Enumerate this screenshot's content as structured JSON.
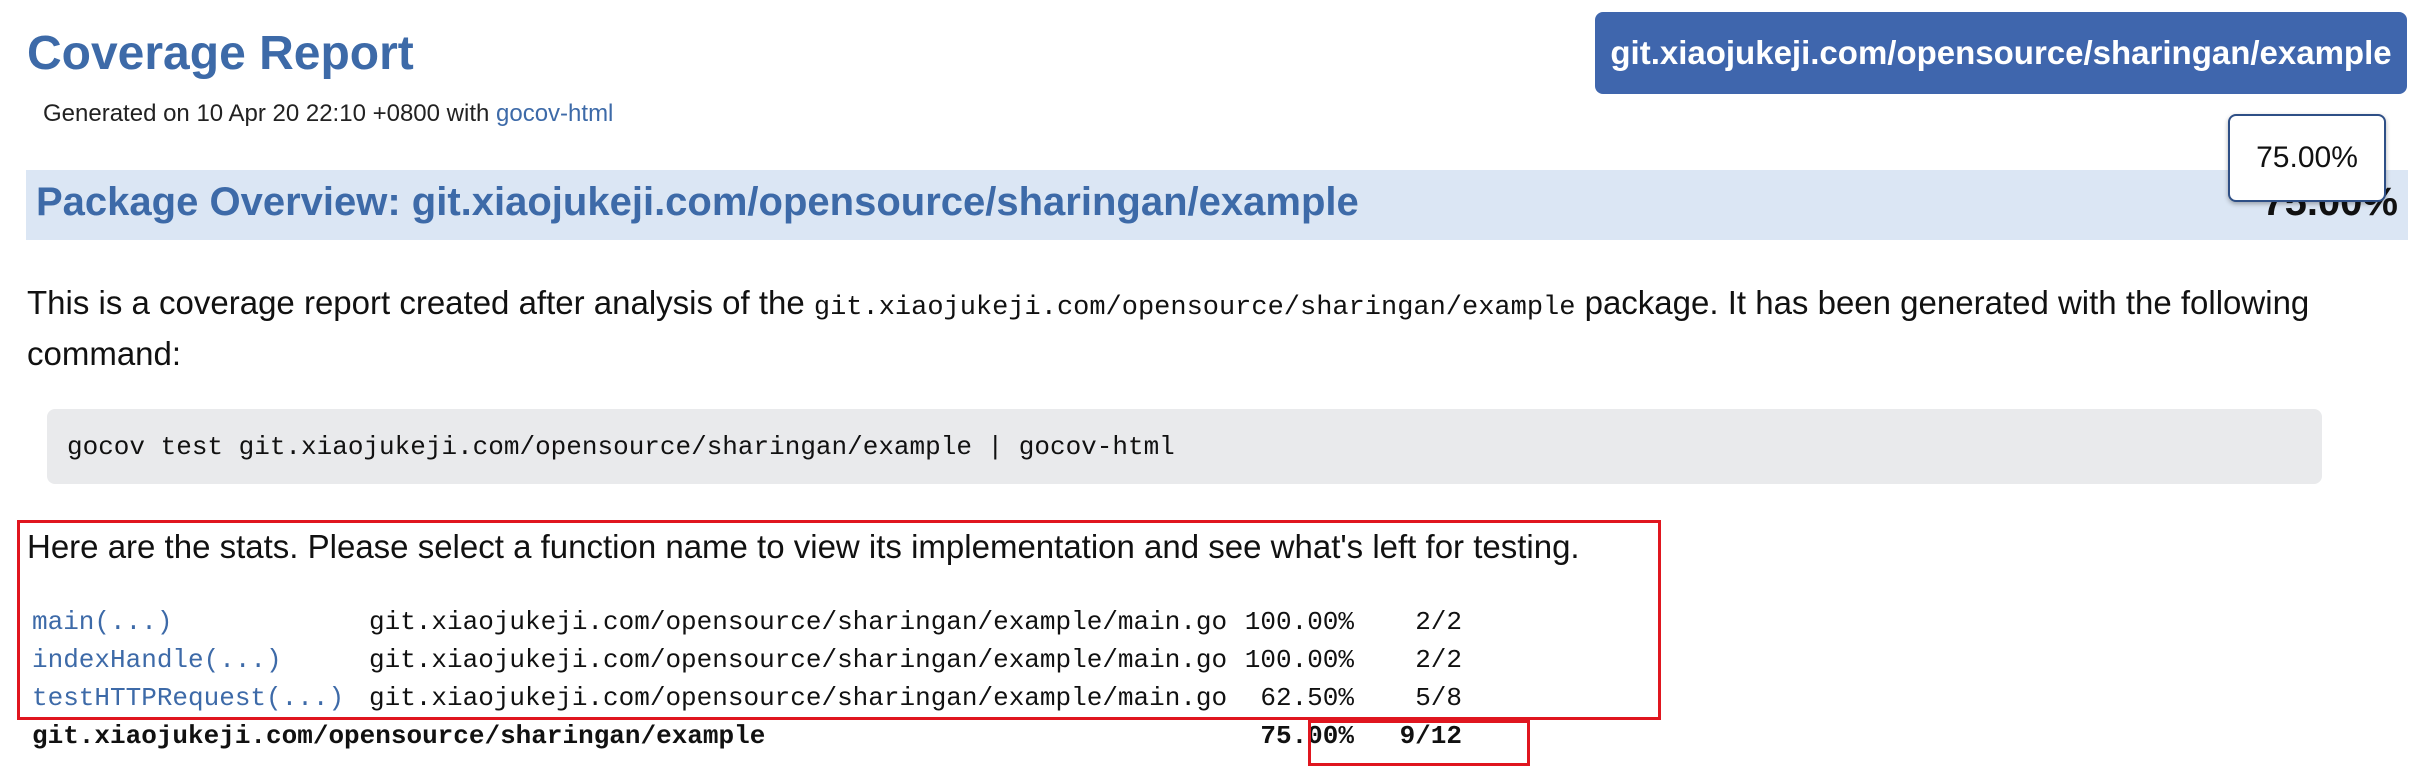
{
  "header": {
    "title": "Coverage Report",
    "generated_prefix": "Generated on 10 Apr 20 22:10 +0800 with ",
    "generator_link": "gocov-html"
  },
  "package_badge": "git.xiaojukeji.com/opensource/sharingan/example",
  "overview": {
    "title": "Package Overview: git.xiaojukeji.com/opensource/sharingan/example",
    "percent": "75.00%"
  },
  "tooltip": {
    "text": "75.00%"
  },
  "intro": {
    "before": "This is a coverage report created after analysis of the ",
    "package_code": "git.xiaojukeji.com/opensource/sharingan/example",
    "after": " package. It has been generated with the following command:"
  },
  "command": "gocov test git.xiaojukeji.com/opensource/sharingan/example | gocov-html",
  "stats": {
    "intro": "Here are the stats. Please select a function name to view its implementation and see what's left for testing.",
    "rows": [
      {
        "function": "main(...)",
        "file": "git.xiaojukeji.com/opensource/sharingan/example/main.go",
        "percent": "100.00%",
        "fraction": "2/2"
      },
      {
        "function": "indexHandle(...)",
        "file": "git.xiaojukeji.com/opensource/sharingan/example/main.go",
        "percent": "100.00%",
        "fraction": "2/2"
      },
      {
        "function": "testHTTPRequest(...)",
        "file": "git.xiaojukeji.com/opensource/sharingan/example/main.go",
        "percent": "62.50%",
        "fraction": "5/8"
      }
    ],
    "total": {
      "package": "git.xiaojukeji.com/opensource/sharingan/example",
      "percent": "75.00%",
      "fraction": "9/12"
    }
  },
  "colors": {
    "accent": "#3d6aa8",
    "badge_bg": "#3f66ad",
    "overview_bg": "#dbe6f4",
    "highlight": "#e0161f"
  }
}
